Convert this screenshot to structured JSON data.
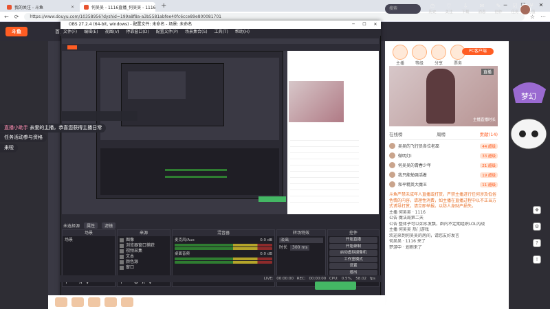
{
  "browser": {
    "tabs": [
      {
        "label": "我的关注 - 斗鱼",
        "active": false
      },
      {
        "label": "何吴吴 - 1116直播_何吴吴 - 1116…",
        "active": true
      }
    ],
    "url": "https://www.douyu.com/10358956?dyshid=199a8f8a-a3b5581abfee40fc6cce89e800081701"
  },
  "site": {
    "logo": "斗鱼",
    "nav_first": "首页",
    "search_placeholder": "搜索",
    "header_icons": [
      "历史",
      "关注",
      "下载",
      "消息",
      "创作",
      "任务",
      "充值"
    ],
    "right_labels": [
      "主播",
      "等级",
      "分享",
      "票务"
    ],
    "pc_client": "PC客户端",
    "poster_label": "直播",
    "right_banner_caption": "主播直播时长"
  },
  "overlays": {
    "assistant_name": "直播小助手",
    "assistant_msg_1": "亲爱的主播，恭喜您获得主播日常",
    "assistant_msg_2": "任务活动参与资格",
    "short_msg": "来啦"
  },
  "obs": {
    "title": "OBS 27.2.4 (64-bit, windows) - 配置文件: 未命名 - 场景: 未命名",
    "menu": [
      "文件(F)",
      "编辑(E)",
      "视图(V)",
      "停靠窗口(D)",
      "配置文件(P)",
      "场景集合(S)",
      "工具(T)",
      "帮助(H)"
    ],
    "no_source": "未选择源",
    "props": "属性",
    "filters": "滤镜",
    "docks": {
      "scenes": {
        "title": "场景",
        "items": [
          "场景"
        ]
      },
      "sources": {
        "title": "来源",
        "items": [
          "图像",
          "浏览器窗口捕获",
          "视频采集",
          "文本",
          "颜色源",
          "窗口"
        ]
      },
      "mixer": {
        "title": "混音器",
        "tracks": [
          {
            "name": "麦克风/Aux",
            "db": "0.0 dB"
          },
          {
            "name": "桌面音频",
            "db": "0.0 dB"
          }
        ]
      },
      "transitions": {
        "title": "转场特效",
        "type": "淡出",
        "duration_label": "时长",
        "duration": "300 ms"
      },
      "controls": {
        "title": "控件",
        "buttons": [
          "开始直播",
          "开始录制",
          "启动虚拟摄像机",
          "工作室模式",
          "设置",
          "退出"
        ]
      }
    },
    "status": "LIVE: 00:00:00   REC: 00:00:00   CPU: 0.5%, 58.02 fps"
  },
  "ranking": {
    "tabs": [
      "在线榜",
      "周榜",
      "贡献(14)"
    ],
    "rows": [
      {
        "name": "吴吴的飞行员各位老巫",
        "badge": "44 超级"
      },
      {
        "name": "微明灯i",
        "badge": "33 超级"
      },
      {
        "name": "何吴吴的青春少年",
        "badge": "21 超级"
      },
      {
        "name": "我只能勉强活着",
        "badge": "19 超级"
      },
      {
        "name": "和平精英大魔王",
        "badge": "11 超级"
      }
    ]
  },
  "chat": {
    "warning": "斗鱼严禁未成年人直播或打赏，严禁主播进行任何涉及低俗色情的内容，请理性消费，如主播在直播过程中以不正当方式诱导打赏，请立即举报。以防人身财产损失。",
    "lines": [
      "主播 何吴吴 · 1116",
      "公告 魔法局第二天",
      "公告 整体子可以如水发飘，群内不定期组织LOL内战",
      "主播 何吴吴 热门游戏",
      "欢迎来到何吴吴的房间，请您友好发言",
      "何吴吴 · 1116 来了",
      "梦游中 · 划刷来了"
    ]
  }
}
